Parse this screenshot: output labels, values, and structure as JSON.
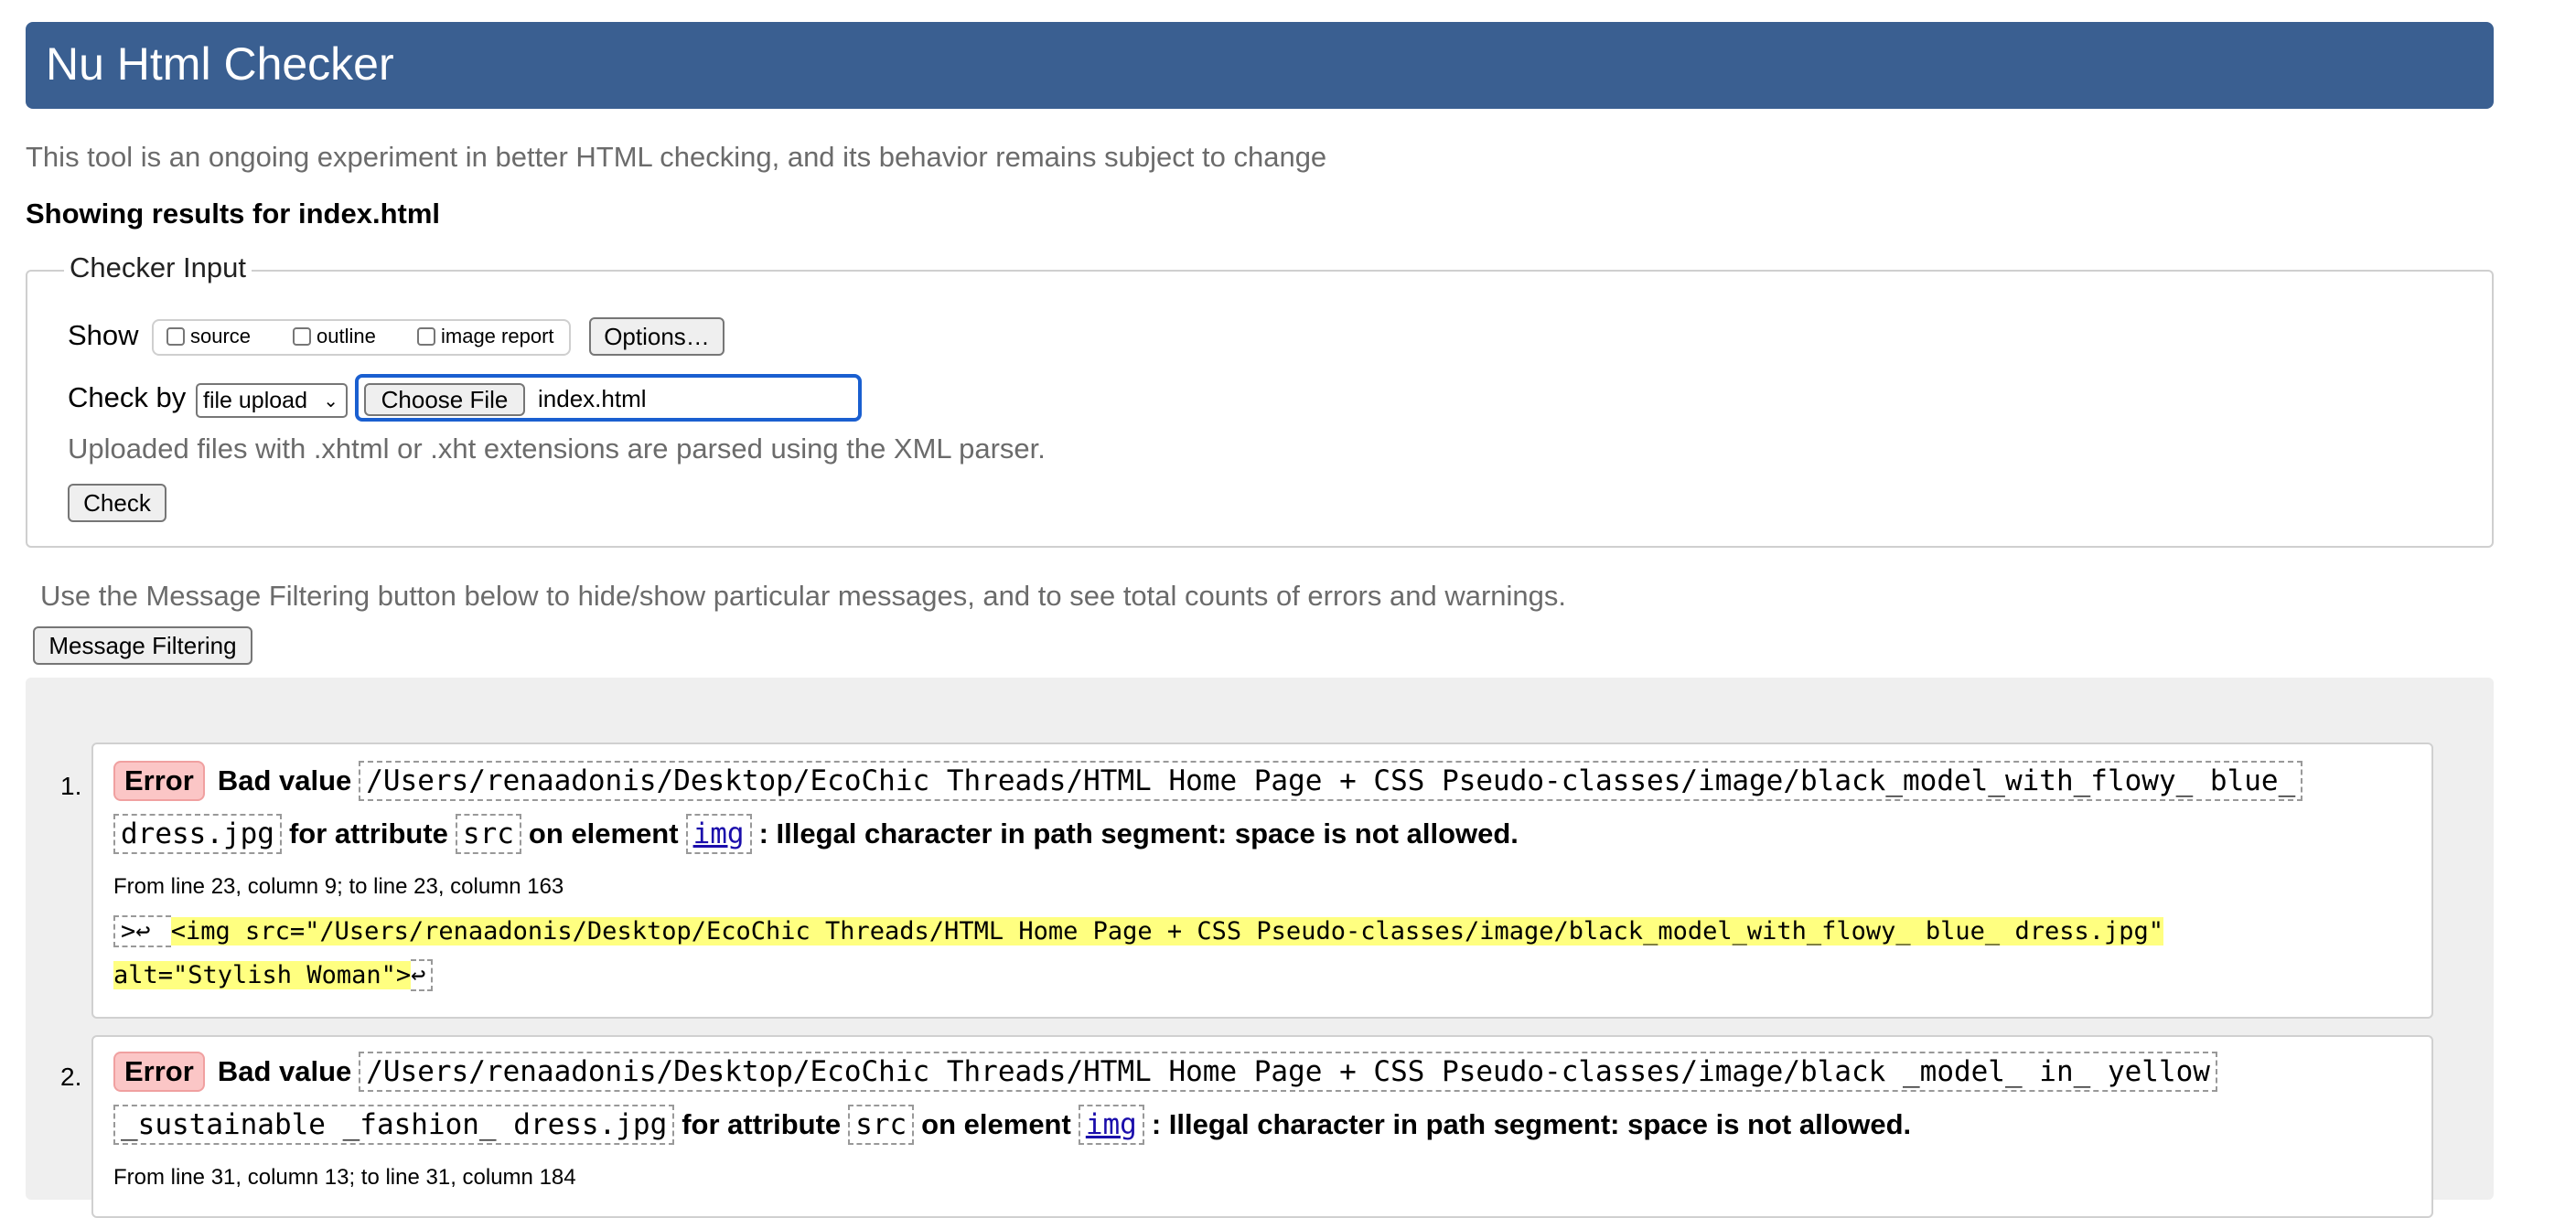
{
  "header": {
    "title": "Nu Html Checker"
  },
  "tagline": "This tool is an ongoing experiment in better HTML checking, and its behavior remains subject to change",
  "showing": {
    "prefix": "Showing results for",
    "filename": "index.html"
  },
  "checker_input": {
    "legend": "Checker Input",
    "show_label": "Show",
    "show_options": [
      "source",
      "outline",
      "image report"
    ],
    "options_button": "Options…",
    "check_by_label": "Check by",
    "check_by_value": "file upload",
    "choose_file_button": "Choose File",
    "chosen_file": "index.html",
    "hint": "Uploaded files with .xhtml or .xht extensions are parsed using the XML parser.",
    "check_button": "Check"
  },
  "filtering": {
    "note": "Use the Message Filtering button below to hide/show particular messages, and to see total counts of errors and warnings.",
    "button": "Message Filtering"
  },
  "messages": [
    {
      "number": "1.",
      "type": "Error",
      "bad_value_label": "Bad value",
      "value_line1": "/Users/renaadonis/Desktop/EcoChic Threads/HTML Home Page + CSS Pseudo-classes/image/black_model_with_flowy_ blue_",
      "value_line2": "dress.jpg",
      "for_attribute": "for attribute",
      "attribute": "src",
      "on_element": "on element",
      "element": "img",
      "message": ": Illegal character in path segment: space is not allowed.",
      "location": "From line 23, column 9; to line 23, column 163",
      "extract_prefix": ">↩        ",
      "extract_line1": "<img src=\"/Users/renaadonis/Desktop/EcoChic Threads/HTML Home Page + CSS Pseudo-classes/image/black_model_with_flowy_ blue_ dress.jpg\"",
      "extract_line2": "alt=\"Stylish Woman\">",
      "extract_suffix": "↩"
    },
    {
      "number": "2.",
      "type": "Error",
      "bad_value_label": "Bad value",
      "value_line1": "/Users/renaadonis/Desktop/EcoChic Threads/HTML Home Page + CSS Pseudo-classes/image/black _model_ in_ yellow",
      "value_line2": "_sustainable _fashion_ dress.jpg",
      "for_attribute": "for attribute",
      "attribute": "src",
      "on_element": "on element",
      "element": "img",
      "message": ": Illegal character in path segment: space is not allowed.",
      "location": "From line 31, column 13; to line 31, column 184"
    }
  ]
}
